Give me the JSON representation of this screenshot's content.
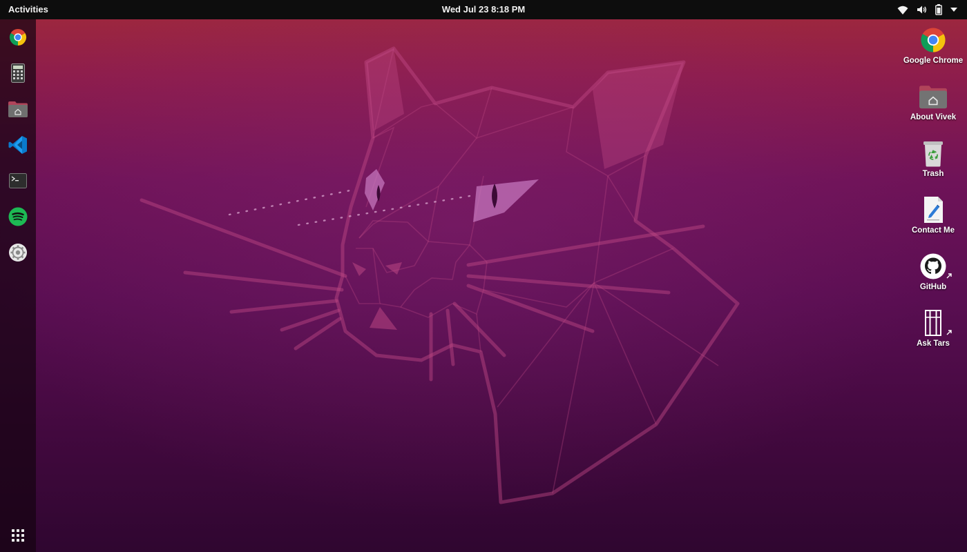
{
  "topbar": {
    "activities_label": "Activities",
    "clock": "Wed Jul 23  8:18 PM",
    "tray_icons": [
      "wifi-icon",
      "volume-icon",
      "battery-icon",
      "system-menu-arrow-icon"
    ]
  },
  "dock": {
    "apps": [
      {
        "name": "Google Chrome",
        "icon": "chrome-icon"
      },
      {
        "name": "Calculator",
        "icon": "calculator-icon"
      },
      {
        "name": "Files",
        "icon": "home-folder-icon"
      },
      {
        "name": "Visual Studio Code",
        "icon": "vscode-icon"
      },
      {
        "name": "Terminal",
        "icon": "terminal-icon"
      },
      {
        "name": "Spotify",
        "icon": "spotify-icon"
      },
      {
        "name": "Settings",
        "icon": "settings-icon"
      }
    ],
    "show_apps_icon": "app-grid-icon"
  },
  "desktop": {
    "icons": [
      {
        "label": "Google Chrome",
        "icon": "chrome-icon"
      },
      {
        "label": "About Vivek",
        "icon": "home-folder-icon"
      },
      {
        "label": "Trash",
        "icon": "trash-icon"
      },
      {
        "label": "Contact Me",
        "icon": "text-editor-icon"
      },
      {
        "label": "GitHub",
        "icon": "github-icon",
        "link": true
      },
      {
        "label": "Ask Tars",
        "icon": "tars-icon",
        "link": true
      }
    ]
  },
  "theme": {
    "topbar_bg": "#0d0d0d",
    "wallpaper_top": "#a12a3a",
    "wallpaper_bottom": "#2f0630",
    "accent": "#e95420"
  }
}
